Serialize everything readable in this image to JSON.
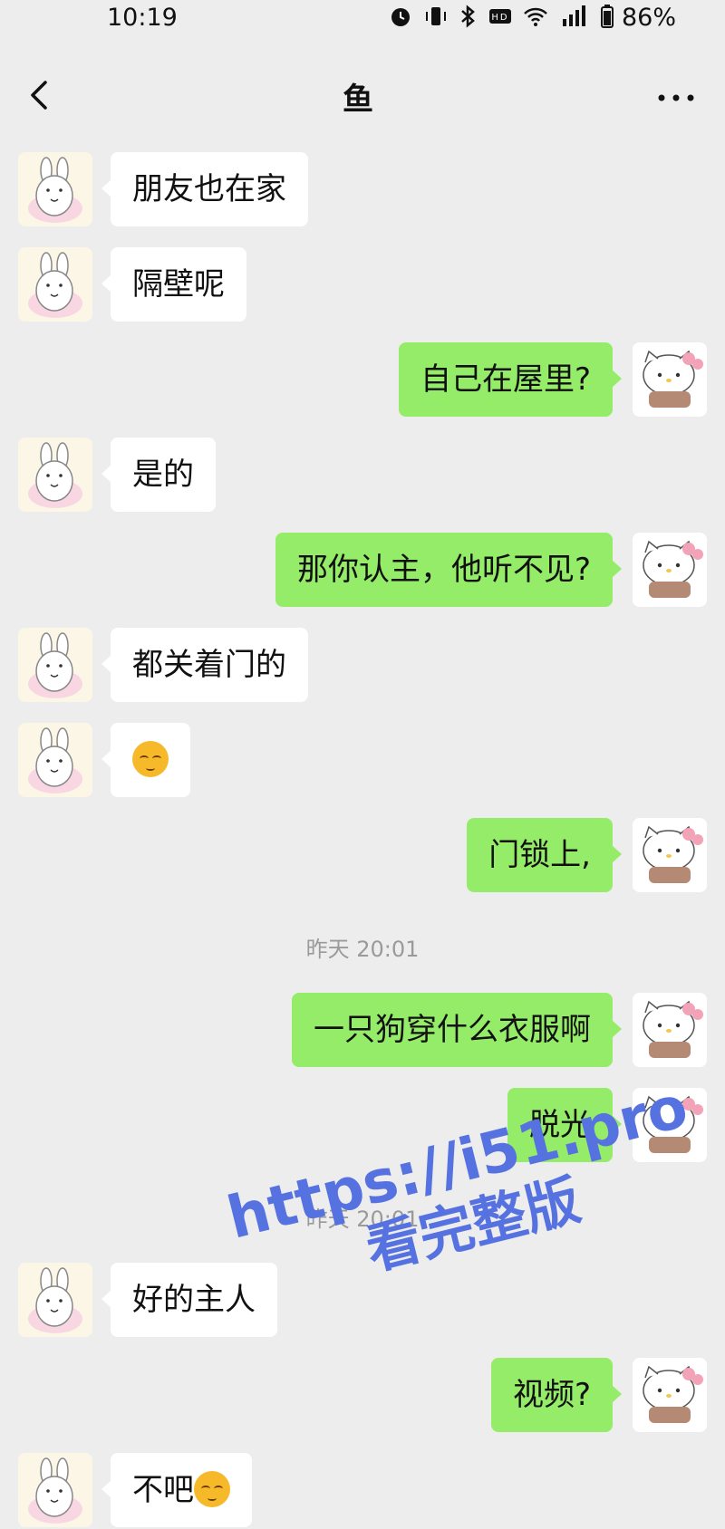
{
  "status_bar": {
    "time": "10:19",
    "icons": [
      "alarm-icon",
      "vibrate-icon",
      "bluetooth-icon",
      "hd-icon",
      "wifi-icon",
      "signal-icon"
    ],
    "battery": "86%"
  },
  "nav": {
    "title": "鱼",
    "back_icon": "chevron-left-icon",
    "more_icon": "more-dots-icon"
  },
  "messages": [
    {
      "side": "left",
      "text": "朋友也在家"
    },
    {
      "side": "left",
      "text": "隔壁呢"
    },
    {
      "side": "right",
      "text": "自己在屋里?"
    },
    {
      "side": "left",
      "text": "是的"
    },
    {
      "side": "right",
      "text": "那你认主，他听不见?"
    },
    {
      "side": "left",
      "text": "都关着门的"
    },
    {
      "side": "left",
      "text": "",
      "emoji": "relieved-face"
    },
    {
      "side": "right",
      "text": "门锁上,"
    },
    {
      "type": "time",
      "text": "昨天 20:01"
    },
    {
      "side": "right",
      "text": "一只狗穿什么衣服啊"
    },
    {
      "side": "right",
      "text": "脱光"
    },
    {
      "type": "time",
      "text": "昨天 20:01"
    },
    {
      "side": "left",
      "text": "好的主人"
    },
    {
      "side": "right",
      "text": "视频?"
    },
    {
      "side": "left",
      "text": "不吧",
      "emoji": "relieved-face"
    }
  ],
  "watermark": {
    "line1": "https://i51.pro",
    "line2": "看完整版"
  },
  "colors": {
    "background": "#ededed",
    "bubble_self": "#95ec69",
    "bubble_other": "#ffffff",
    "watermark": "#5672e0"
  }
}
